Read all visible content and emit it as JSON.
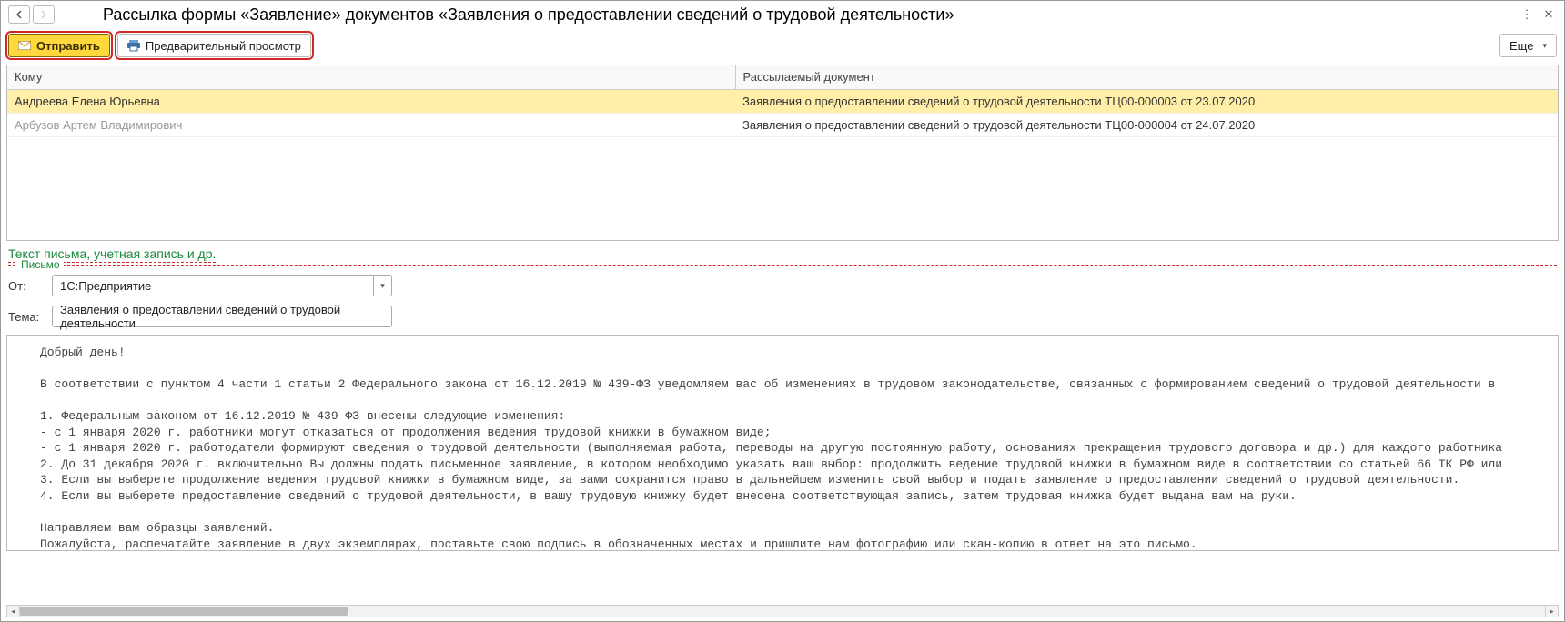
{
  "titlebar": {
    "title": "Рассылка формы «Заявление» документов «Заявления о предоставлении сведений о трудовой деятельности»"
  },
  "toolbar": {
    "send_label": "Отправить",
    "preview_label": "Предварительный просмотр",
    "more_label": "Еще"
  },
  "table": {
    "col_to": "Кому",
    "col_doc": "Рассылаемый документ",
    "rows": [
      {
        "to": "Андреева Елена Юрьевна",
        "doc": "Заявления о предоставлении сведений о трудовой деятельности ТЦ00-000003 от 23.07.2020"
      },
      {
        "to": "Арбузов Артем Владимирович",
        "doc": "Заявления о предоставлении сведений о трудовой деятельности ТЦ00-000004 от 24.07.2020"
      }
    ]
  },
  "link_expander": "Текст письма, учетная запись и др.",
  "group": {
    "legend": "Письмо",
    "from_label": "От:",
    "from_value": "1С:Предприятие",
    "subject_label": "Тема:",
    "subject_value": "Заявления о предоставлении сведений о трудовой деятельности"
  },
  "body_text": "Добрый день!\n\nВ соответствии с пунктом 4 части 1 статьи 2 Федерального закона от 16.12.2019 № 439-ФЗ уведомляем вас об изменениях в трудовом законодательстве, связанных с формированием сведений о трудовой деятельности в\n\n1. Федеральным законом от 16.12.2019 № 439-ФЗ внесены следующие изменения:\n- с 1 января 2020 г. работники могут отказаться от продолжения ведения трудовой книжки в бумажном виде;\n- с 1 января 2020 г. работодатели формируют сведения о трудовой деятельности (выполняемая работа, переводы на другую постоянную работу, основаниях прекращения трудового договора и др.) для каждого работника\n2. До 31 декабря 2020 г. включительно Вы должны подать письменное заявление, в котором необходимо указать ваш выбор: продолжить ведение трудовой книжки в бумажном виде в соответствии со статьей 66 ТК РФ или\n3. Если вы выберете продолжение ведения трудовой книжки в бумажном виде, за вами сохранится право в дальнейшем изменить свой выбор и подать заявление о предоставлении сведений о трудовой деятельности.\n4. Если вы выберете предоставление сведений о трудовой деятельности, в вашу трудовую книжку будет внесена соответствующая запись, затем трудовая книжка будет выдана вам на руки.\n\nНаправляем вам образцы заявлений.\nПожалуйста, распечатайте заявление в двух экземплярах, поставьте свою подпись в обозначенных местах и пришлите нам фотографию или скан-копию в ответ на это письмо.\n\nС уважением, Администрация."
}
